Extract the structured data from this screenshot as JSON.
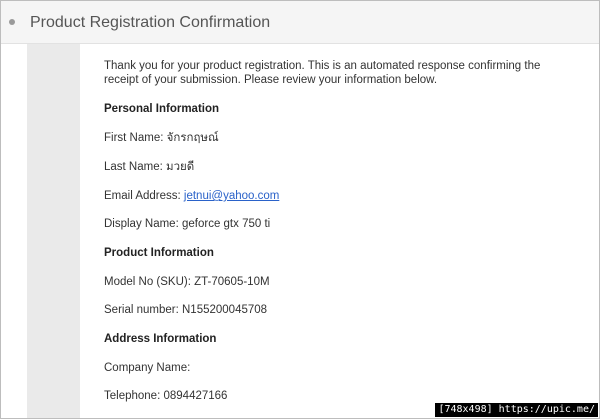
{
  "header": {
    "title": "Product Registration Confirmation"
  },
  "intro": "Thank you for your product registration. This is an automated response confirming the receipt of your submission. Please review your information below.",
  "personal": {
    "heading": "Personal Information",
    "first_name_label": "First Name:",
    "first_name": "จักรกฤษณ์",
    "last_name_label": "Last Name:",
    "last_name": "มวยดี",
    "email_label": "Email Address:",
    "email": "jetnui@yahoo.com",
    "display_name_label": "Display Name:",
    "display_name": "geforce gtx 750 ti"
  },
  "product": {
    "heading": "Product Information",
    "model_label": "Model No (SKU):",
    "model": "ZT-70605-10M",
    "serial_label": "Serial number:",
    "serial": "N155200045708"
  },
  "address": {
    "heading": "Address Information",
    "company_label": "Company Name:",
    "company": "",
    "telephone_label": "Telephone:",
    "telephone": "0894427166"
  },
  "watermark": "[748x498] https://upic.me/"
}
